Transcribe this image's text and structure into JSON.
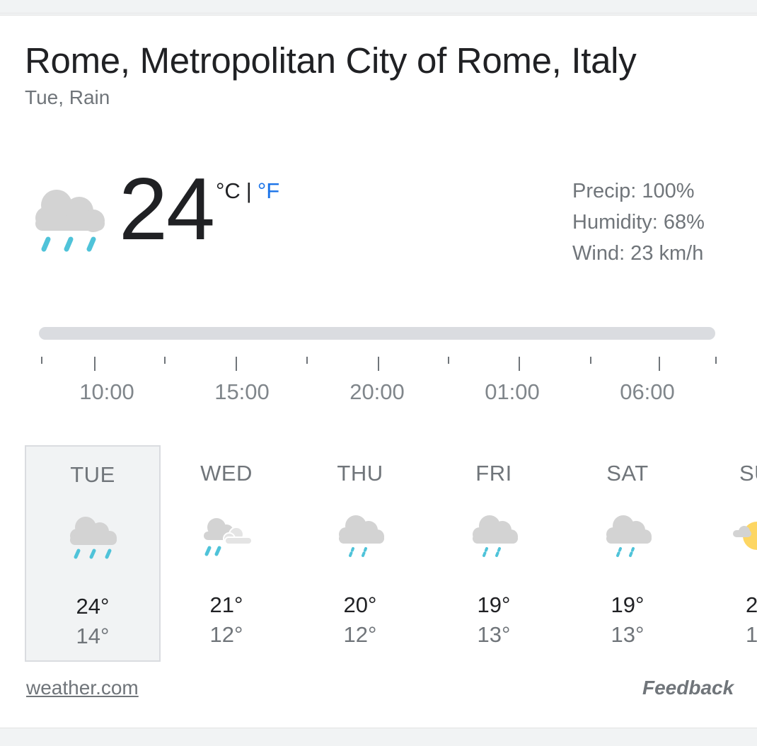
{
  "location": "Rome, Metropolitan City of Rome, Italy",
  "subtitle": "Tue, Rain",
  "current": {
    "temperature": "24",
    "unit_c": "°C",
    "unit_sep": "|",
    "unit_f": "°F",
    "icon": "rain-icon",
    "precip": "Precip: 100%",
    "humidity": "Humidity: 68%",
    "wind": "Wind: 23 km/h"
  },
  "timeline": {
    "labels": [
      "10:00",
      "15:00",
      "20:00",
      "01:00",
      "06:00"
    ]
  },
  "forecast": [
    {
      "day": "TUE",
      "high": "24°",
      "low": "14°",
      "icon": "rain-icon",
      "selected": true
    },
    {
      "day": "WED",
      "high": "21°",
      "low": "12°",
      "icon": "rain-cloudy-icon"
    },
    {
      "day": "THU",
      "high": "20°",
      "low": "12°",
      "icon": "light-rain-icon"
    },
    {
      "day": "FRI",
      "high": "19°",
      "low": "13°",
      "icon": "light-rain-icon"
    },
    {
      "day": "SAT",
      "high": "19°",
      "low": "13°",
      "icon": "light-rain-icon"
    },
    {
      "day": "SU",
      "high": "2",
      "low": "1",
      "icon": "partly-sunny-icon"
    }
  ],
  "footer": {
    "source": "weather.com",
    "feedback": "Feedback"
  },
  "colors": {
    "rain": "#4fc3d9",
    "cloud": "#d3d3d3",
    "sun": "#fdd663",
    "link_blue": "#1a73e8"
  }
}
